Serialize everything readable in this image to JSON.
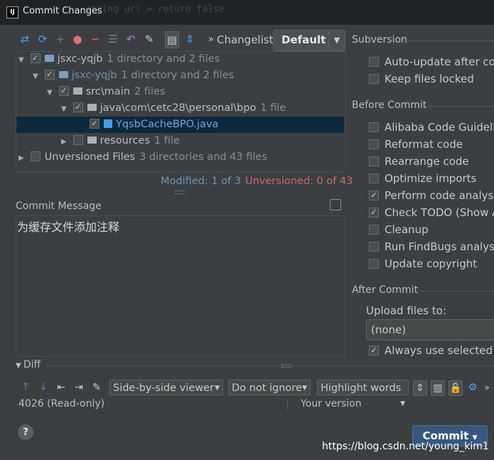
{
  "window": {
    "title": "Commit Changes",
    "app_icon": "IJ",
    "background_code": "string url = return false"
  },
  "toolbar": {
    "changelist_label": "Changelist:",
    "changelist_value": "Default",
    "icons": [
      "diff-arrow-icon",
      "refresh-icon",
      "add-icon",
      "colored-icon",
      "remove-icon",
      "group-icon",
      "undo-icon",
      "edit-source-icon",
      "show-diff-icon",
      "expand-icon",
      "more-icon"
    ]
  },
  "tree": {
    "rows": [
      {
        "label": "jsxc-yqjb",
        "hint": "1 directory and 2 files"
      },
      {
        "label": "jsxc-yqjb",
        "hint": "1 directory and 2 files"
      },
      {
        "label": "src\\main",
        "hint": "2 files"
      },
      {
        "label": "java\\com\\cetc28\\personal\\bpo",
        "hint": "1 file"
      },
      {
        "label": "YqsbCacheBPO.java",
        "hint": ""
      },
      {
        "label": "resources",
        "hint": "1 file"
      },
      {
        "label": "Unversioned Files",
        "hint": "3 directories and 43 files"
      }
    ]
  },
  "status": {
    "modified": "Modified: 1 of 3",
    "unversioned": "Unversioned: 0 of 43"
  },
  "commit_message": {
    "label": "Commit Message",
    "text": "为缓存文件添加注释"
  },
  "subversion": {
    "title": "Subversion",
    "options": [
      "Auto-update after com",
      "Keep files locked"
    ]
  },
  "before_commit": {
    "title": "Before Commit",
    "options": [
      "Alibaba Code Guidelin",
      "Reformat code",
      "Rearrange code",
      "Optimize imports",
      "Perform code analysis",
      "Check TODO (Show All",
      "Cleanup",
      "Run FindBugs analysis",
      "Update copyright"
    ],
    "checked": [
      false,
      false,
      false,
      false,
      true,
      true,
      false,
      false,
      false
    ]
  },
  "after_commit": {
    "title": "After Commit",
    "upload_label": "Upload files to:",
    "upload_value": "(none)",
    "always_use": "Always use selected ser"
  },
  "diff": {
    "label": "Diff",
    "viewer": "Side-by-side viewer",
    "ignore": "Do not ignore",
    "highlight": "Highlight words",
    "left_info": "4026 (Read-only)",
    "right_info": "Your version"
  },
  "buttons": {
    "commit": "Commit",
    "help": "?"
  },
  "watermark": "https://blog.csdn.net/young_kim1",
  "colors": {
    "background": "#3c3f41",
    "selection": "#0d293e",
    "link_blue": "#6897bb",
    "error_red": "#cc666e",
    "commit_button": "#365880"
  }
}
